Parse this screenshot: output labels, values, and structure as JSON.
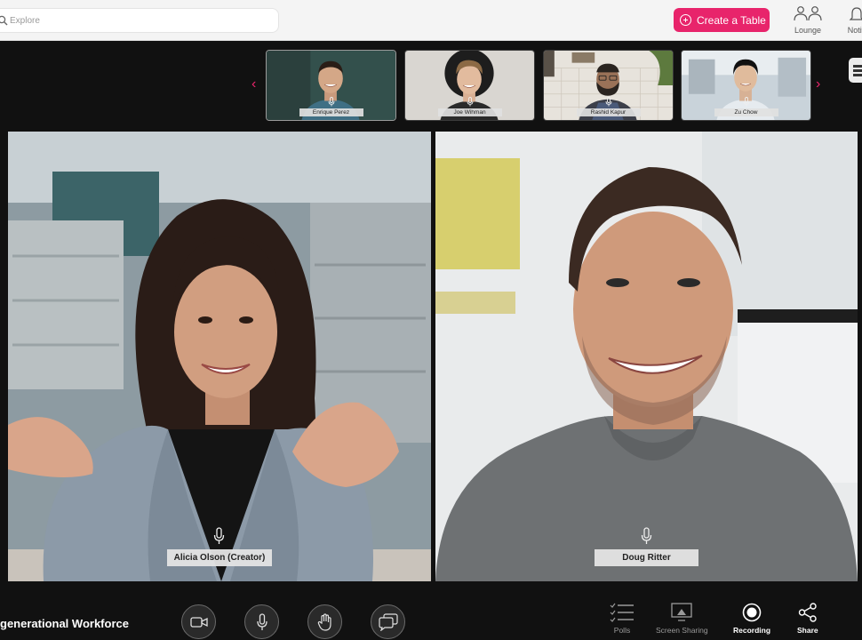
{
  "header": {
    "search": {
      "placeholder": "Explore"
    },
    "create_button": "Create a Table",
    "nav": [
      {
        "label": "Lounge",
        "icon": "people-icon"
      },
      {
        "label": "Notifi",
        "icon": "bell-icon"
      }
    ]
  },
  "participants_strip": [
    {
      "name": "Enrique Perez",
      "active": true
    },
    {
      "name": "Joe Wihman",
      "active": false
    },
    {
      "name": "Rashid Kapur",
      "active": false
    },
    {
      "name": "Zu Chow",
      "active": false
    }
  ],
  "main_tiles": [
    {
      "name": "Alicia Olson (Creator)"
    },
    {
      "name": "Doug Ritter"
    }
  ],
  "footer": {
    "session_title": "generational Workforce",
    "controls": [
      {
        "icon": "camera-icon"
      },
      {
        "icon": "microphone-icon"
      },
      {
        "icon": "raise-hand-icon"
      },
      {
        "icon": "chat-icon"
      }
    ],
    "tools": [
      {
        "label": "Polls",
        "icon": "polls-icon",
        "active": false
      },
      {
        "label": "Screen Sharing",
        "icon": "screen-share-icon",
        "active": false
      },
      {
        "label": "Recording",
        "icon": "record-icon",
        "active": true
      },
      {
        "label": "Share",
        "icon": "share-icon",
        "active": true
      }
    ]
  },
  "colors": {
    "accent": "#e8246b",
    "background": "#111111",
    "topbar": "#f4f4f4",
    "name_plate": "#e4e4e4"
  }
}
